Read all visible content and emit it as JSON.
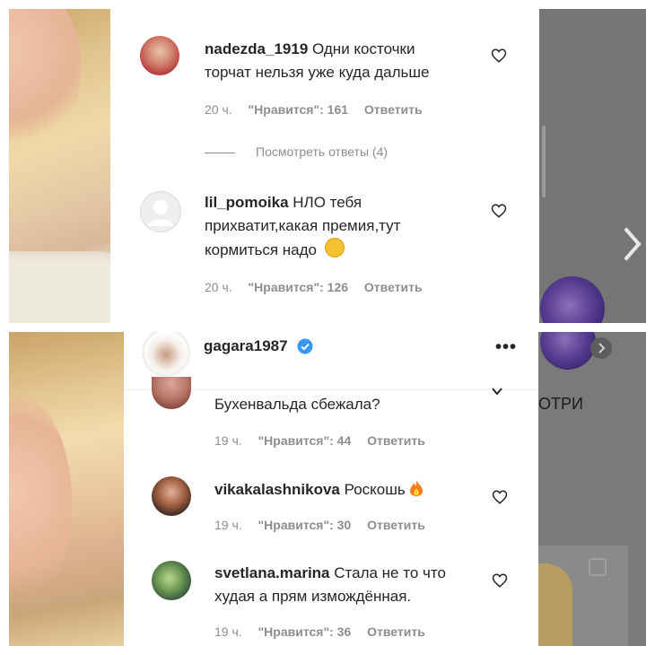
{
  "top": {
    "comments": [
      {
        "username": "nadezda_1919",
        "text_line1": "Одни косточки",
        "text_line2": "торчат нельзя уже куда дальше",
        "time": "20 ч.",
        "likes": "\"Нравится\": 161",
        "reply": "Ответить"
      },
      {
        "username": "lil_pomoika",
        "text_line1": "НЛО тебя",
        "text_line2": "прихватит,какая премия,тут",
        "text_line3": "кормиться надо",
        "time": "20 ч.",
        "likes": "\"Нравится\": 126",
        "reply": "Ответить"
      }
    ],
    "view_replies": "Посмотреть ответы (4)"
  },
  "bottom": {
    "header_username": "gagara1987",
    "partial_side_text": "ОТРИ",
    "partial_comment": {
      "text": "Бухенвальда сбежала?",
      "time": "19 ч.",
      "likes": "\"Нравится\": 44",
      "reply": "Ответить"
    },
    "comments": [
      {
        "username": "vikakalashnikova",
        "text": "Роскошь",
        "time": "19 ч.",
        "likes": "\"Нравится\": 30",
        "reply": "Ответить"
      },
      {
        "username": "svetlana.marina",
        "text_line1": "Стала не то что",
        "text_line2": "худая а прям измождённая.",
        "time": "19 ч.",
        "likes": "\"Нравится\": 36",
        "reply": "Ответить"
      }
    ]
  },
  "colors": {
    "overlay": "#767676",
    "verified": "#3897f0",
    "meta_text": "#8e8e8e"
  }
}
